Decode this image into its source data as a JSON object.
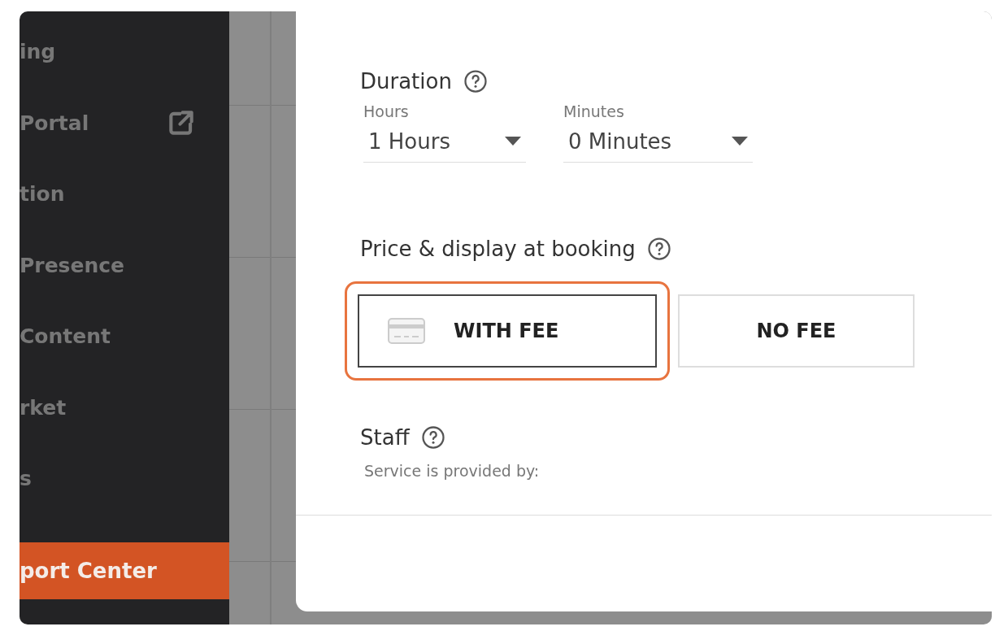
{
  "sidebar": {
    "items": [
      {
        "label": "ing",
        "external_link": false,
        "selected": false
      },
      {
        "label": "Portal",
        "external_link": true,
        "selected": false
      },
      {
        "label": "tion",
        "external_link": false,
        "selected": false
      },
      {
        "label": "Presence",
        "external_link": false,
        "selected": false
      },
      {
        "label": "Content",
        "external_link": false,
        "selected": false
      },
      {
        "label": "rket",
        "external_link": false,
        "selected": false
      },
      {
        "label": "s",
        "external_link": false,
        "selected": false
      },
      {
        "label": "port Center",
        "external_link": false,
        "selected": true
      }
    ]
  },
  "modal": {
    "sections": [
      {
        "kind": "duration",
        "title": "Duration",
        "selects": [
          {
            "label": "Hours",
            "value": "1 Hours"
          },
          {
            "label": "Minutes",
            "value": "0 Minutes"
          }
        ]
      },
      {
        "kind": "price",
        "title": "Price & display at booking",
        "options": [
          {
            "label": "WITH FEE",
            "kind": "card",
            "selected": true
          },
          {
            "label": "NO FEE",
            "kind": "plain",
            "selected": false
          }
        ]
      },
      {
        "kind": "staff",
        "title": "Staff",
        "note": "Service is provided by:"
      }
    ]
  }
}
